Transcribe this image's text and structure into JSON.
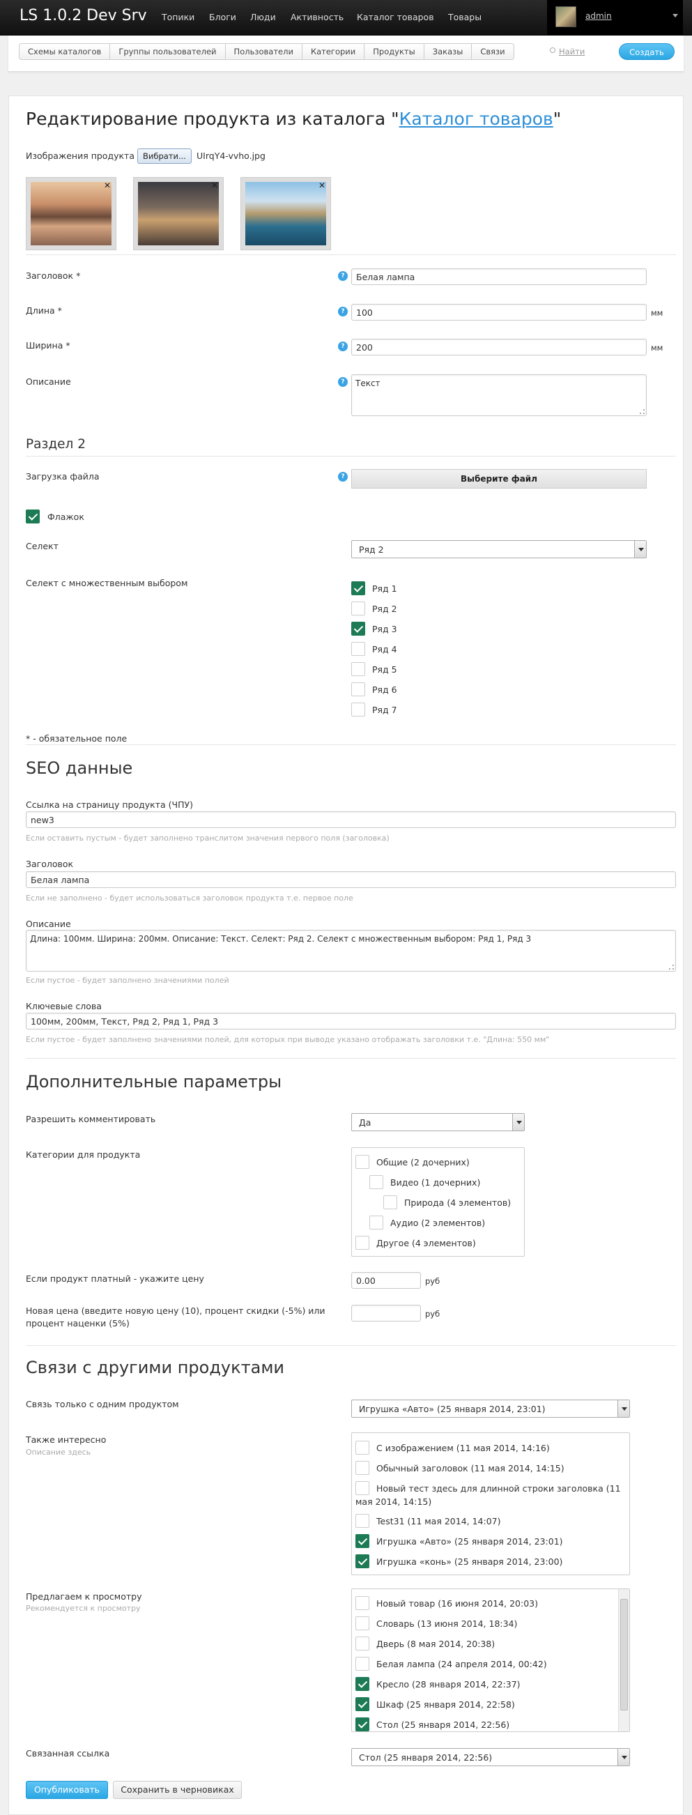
{
  "header": {
    "logo": "LS 1.0.2 Dev Srv",
    "nav": [
      "Топики",
      "Блоги",
      "Люди",
      "Активность",
      "Каталог товаров",
      "Товары"
    ],
    "username": "admin"
  },
  "subnav": {
    "tabs": [
      "Схемы каталогов",
      "Группы пользователей",
      "Пользователи",
      "Категории",
      "Продукты",
      "Заказы",
      "Связи"
    ],
    "search": "Найти",
    "create": "Создать"
  },
  "page": {
    "title_prefix": "Редактирование продукта из каталога \"",
    "title_link": "Каталог товаров",
    "title_suffix": "\""
  },
  "images": {
    "label": "Изображения продукта",
    "browse": "Вибрати...",
    "filename": "UIrqY4-vvho.jpg"
  },
  "fields": {
    "title": {
      "label": "Заголовок *",
      "value": "Белая лампа"
    },
    "length": {
      "label": "Длина *",
      "value": "100",
      "unit": "мм"
    },
    "width": {
      "label": "Ширина *",
      "value": "200",
      "unit": "мм"
    },
    "desc": {
      "label": "Описание",
      "value": "Текст"
    },
    "section2": "Раздел 2",
    "upload": {
      "label": "Загрузка файла",
      "button": "Выберите файл"
    },
    "flag": {
      "label": "Флажок",
      "checked": true
    },
    "select": {
      "label": "Селект",
      "value": "Ряд 2"
    },
    "multi": {
      "label": "Селект с множественным выбором",
      "options": [
        {
          "t": "Ряд 1",
          "c": true
        },
        {
          "t": "Ряд 2",
          "c": false
        },
        {
          "t": "Ряд 3",
          "c": true
        },
        {
          "t": "Ряд 4",
          "c": false
        },
        {
          "t": "Ряд 5",
          "c": false
        },
        {
          "t": "Ряд 6",
          "c": false
        },
        {
          "t": "Ряд 7",
          "c": false
        }
      ]
    },
    "required": "* - обязательное поле"
  },
  "seo": {
    "heading": "SEO данные",
    "url_label": "Ссылка на страницу продукта (ЧПУ)",
    "url_value": "new3",
    "url_hint": "Если оставить пустым - будет заполнено транслитом значения первого поля (заголовка)",
    "title_label": "Заголовок",
    "title_value": "Белая лампа",
    "title_hint": "Если не заполнено - будет использоваться заголовок продукта т.е. первое поле",
    "desc_label": "Описание",
    "desc_value": "Длина: 100мм. Ширина: 200мм. Описание: Текст. Селект: Ряд 2. Селект с множественным выбором: Ряд 1, Ряд 3",
    "desc_hint": "Если пустое - будет заполнено значениями полей",
    "kw_label": "Ключевые слова",
    "kw_value": "100мм, 200мм, Текст, Ряд 2, Ряд 1, Ряд 3",
    "kw_hint": "Если пустое - будет заполнено значениями полей, для которых при выводе указано отображать заголовки т.е. \"Длина: 550 мм\""
  },
  "extra": {
    "heading": "Дополнительные параметры",
    "comments_label": "Разрешить комментировать",
    "comments_value": "Да",
    "cats_label": "Категории для продукта",
    "cats": [
      {
        "t": "Общие (2 дочерних)",
        "lvl": 0
      },
      {
        "t": "Видео (1 дочерних)",
        "lvl": 1
      },
      {
        "t": "Природа (4 элементов)",
        "lvl": 2
      },
      {
        "t": "Аудио (2 элементов)",
        "lvl": 1
      },
      {
        "t": "Другое (4 элементов)",
        "lvl": 0
      }
    ],
    "price_label": "Если продукт платный - укажите цену",
    "price_value": "0.00",
    "price_unit": "руб",
    "newprice_label1": "Новая цена (введите новую цену (10), процент скидки (-5%) или",
    "newprice_label2": "процент наценки (5%)",
    "newprice_unit": "руб"
  },
  "links": {
    "heading": "Связи с другими продуктами",
    "single_label": "Связь только с одним продуктом",
    "single_value": "Игрушка «Авто» (25 января 2014, 23:01)",
    "also_label": "Также интересно",
    "also_hint": "Описание здесь",
    "also": [
      {
        "t": "С изображением (11 мая 2014, 14:16)",
        "c": false
      },
      {
        "t": "Обычный заголовок (11 мая 2014, 14:15)",
        "c": false
      },
      {
        "t": "Новый тест здесь для длинной строки заголовка (11",
        "t2": "мая 2014, 14:15)",
        "c": false
      },
      {
        "t": "Test31 (11 мая 2014, 14:07)",
        "c": false
      },
      {
        "t": "Игрушка «Авто» (25 января 2014, 23:01)",
        "c": true
      },
      {
        "t": "Игрушка «конь» (25 января 2014, 23:00)",
        "c": true
      }
    ],
    "offer_label": "Предлагаем к просмотру",
    "offer_hint": "Рекомендуется к просмотру",
    "offer": [
      {
        "t": "Новый товар (16 июня 2014, 20:03)",
        "c": false
      },
      {
        "t": "Словарь (13 июня 2014, 18:34)",
        "c": false
      },
      {
        "t": "Дверь (8 мая 2014, 20:38)",
        "c": false
      },
      {
        "t": "Белая лампа (24 апреля 2014, 00:42)",
        "c": false
      },
      {
        "t": "Кресло (28 января 2014, 22:37)",
        "c": true
      },
      {
        "t": "Шкаф (25 января 2014, 22:58)",
        "c": true
      },
      {
        "t": "Стол (25 января 2014, 22:56)",
        "c": true
      }
    ],
    "related_label": "Связанная ссылка",
    "related_value": "Стол (25 января 2014, 22:56)"
  },
  "buttons": {
    "publish": "Опубликовать",
    "draft": "Сохранить в черновиках"
  }
}
